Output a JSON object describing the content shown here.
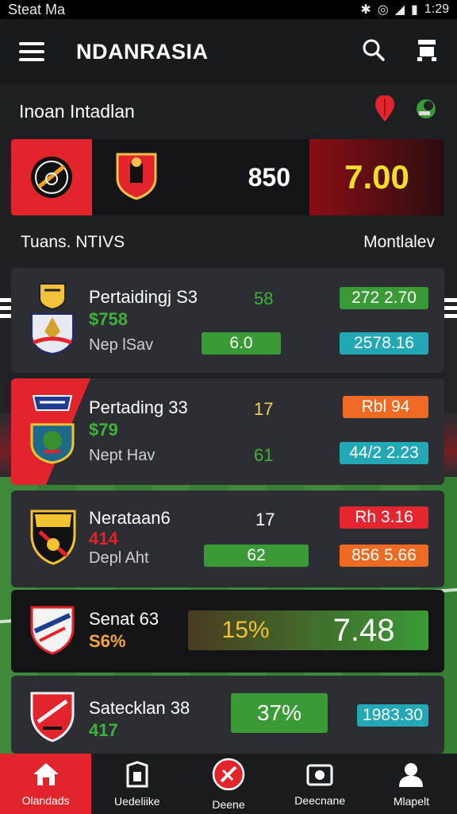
{
  "status_bar": {
    "carrier": "Steat Ma",
    "time": "1:29"
  },
  "app_bar": {
    "title": "NDANRASIA"
  },
  "section": {
    "title": "Inoan Intadlan"
  },
  "featured": {
    "score": "850",
    "odd": "7.00"
  },
  "list_header": {
    "left": "Tuans. NTIVS",
    "right": "Montlalev"
  },
  "matches": [
    {
      "name": "Pertaidingj S3",
      "sub": "$758",
      "sub2": "Nep lSav",
      "stat1": "58",
      "bar1": "6.0",
      "odd_top": "272 2.70",
      "odd_bottom": "2578.16"
    },
    {
      "name": "Pertading 33",
      "sub": "$79",
      "sub2": "Nept Hav",
      "stat1": "17",
      "bar1": "61",
      "odd_top": "Rbl 94",
      "odd_bottom": "44/2 2.23"
    },
    {
      "name": "Nerataan6",
      "sub": "414",
      "sub2": "Depl Aht",
      "stat1": "17",
      "bar1": "62",
      "odd_top": "Rh 3.16",
      "odd_bottom": "856 5.66"
    },
    {
      "name": "Senat 63",
      "sub": "S6%",
      "pct": "15%",
      "big_odd": "7.48"
    },
    {
      "name": "Satecklan 38",
      "sub": "417",
      "pct": "37%",
      "odd_bottom": "1983.30"
    }
  ],
  "bottom_nav": [
    {
      "label": "Olandads",
      "active": true
    },
    {
      "label": "Uedeliike"
    },
    {
      "label": "Deene"
    },
    {
      "label": "Deecnane"
    },
    {
      "label": "Mlapelt"
    }
  ],
  "colors": {
    "accent": "#e2252b",
    "green": "#3a9b36",
    "cyan": "#23a8b6",
    "orange": "#ef6b23",
    "yellow": "#f6df2a"
  }
}
